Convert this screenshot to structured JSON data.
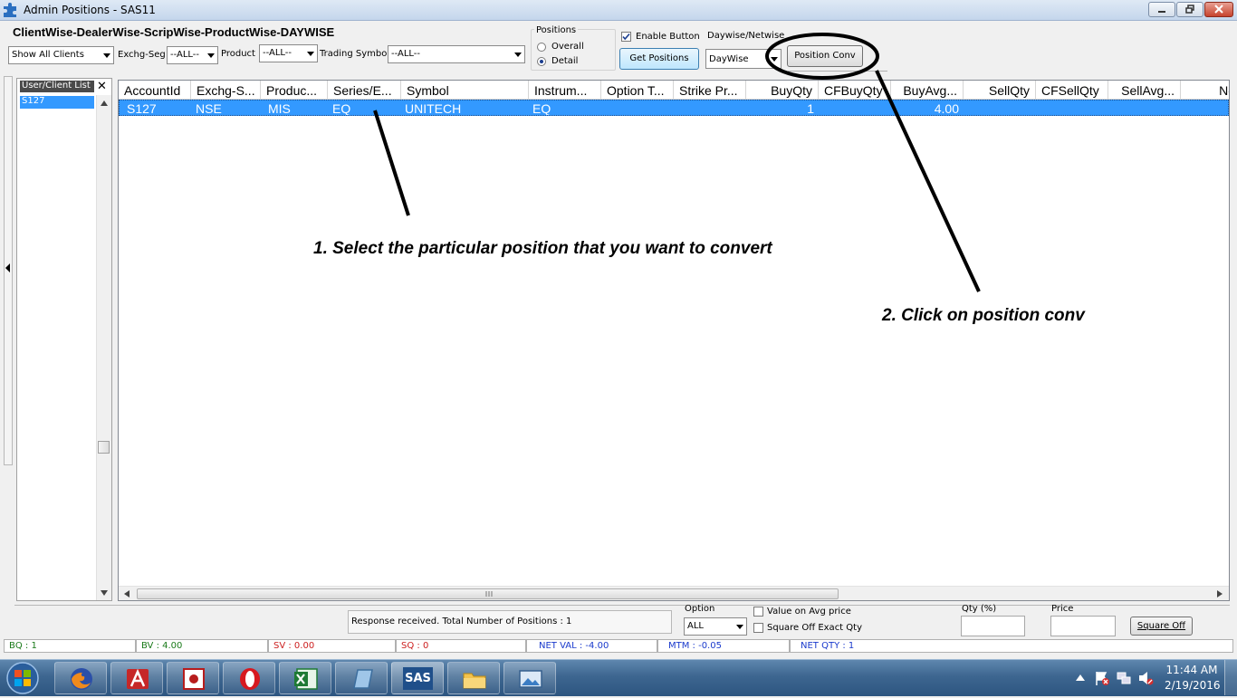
{
  "window": {
    "title": "Admin Positions - SAS11"
  },
  "heading": "ClientWise-DealerWise-ScripWise-ProductWise-DAYWISE",
  "filters": {
    "clients": "Show All Clients",
    "exchg_seg_label": "Exchg-Seg",
    "exchg_seg": "--ALL--",
    "product_label": "Product",
    "product": "--ALL--",
    "trading_symbol_label": "Trading Symbol",
    "trading_symbol": "--ALL--"
  },
  "positions_group": {
    "label": "Positions",
    "overall": "Overall",
    "detail": "Detail",
    "selected": "Detail"
  },
  "enable_button": {
    "label": "Enable Button",
    "checked": true
  },
  "get_positions": "Get Positions",
  "daywise": {
    "label": "Daywise/Netwise",
    "value": "DayWise"
  },
  "position_conv": "Position Conv",
  "client_list": {
    "header": "User/Client List",
    "items": [
      "S127"
    ]
  },
  "grid": {
    "columns": [
      "AccountId",
      "Exchg-S...",
      "Produc...",
      "Series/E...",
      "Symbol",
      "Instrum...",
      "Option T...",
      "Strike Pr...",
      "BuyQty",
      "CFBuyQty",
      "BuyAvg...",
      "SellQty",
      "CFSellQty",
      "SellAvg...",
      "Ne"
    ],
    "rows": [
      {
        "account": "S127",
        "exchg": "NSE",
        "product": "MIS",
        "series": "EQ",
        "symbol": "UNITECH",
        "instrument": "EQ",
        "buyqty": "1",
        "buyavg": "4.00"
      }
    ]
  },
  "annotations": {
    "step1": "1. Select the particular position that you want to convert",
    "step2": "2. Click on position conv"
  },
  "bottom": {
    "response": "Response received. Total Number of Positions : 1",
    "option_label": "Option",
    "option_value": "ALL",
    "value_on_avg": "Value on Avg  price",
    "square_off_exact": "Square Off Exact Qty",
    "qty_label": "Qty (%)",
    "price_label": "Price",
    "square_off": "Square Off"
  },
  "status": {
    "bq": "BQ : 1",
    "bv": "BV : 4.00",
    "sv": "SV : 0.00",
    "sq": "SQ : 0",
    "net_val": "NET VAL : -4.00",
    "mtm": "MTM : -0.05",
    "net_qty": "NET QTY : 1",
    "green": "#1a7a1a",
    "red": "#cc2020",
    "blue": "#1a3acc"
  },
  "taskbar": {
    "apps": [
      "start-orb-icon",
      "firefox-icon",
      "autocad-icon",
      "media-app-icon",
      "opera-icon",
      "excel-icon",
      "notepad-icon",
      "sas-app-icon",
      "file-explorer-icon",
      "photo-viewer-icon"
    ],
    "sas_label": "SAS",
    "time": "11:44 AM",
    "date": "2/19/2016"
  },
  "colors": {
    "selection": "#3399ff",
    "title_gradient": "#c4d6ec"
  }
}
